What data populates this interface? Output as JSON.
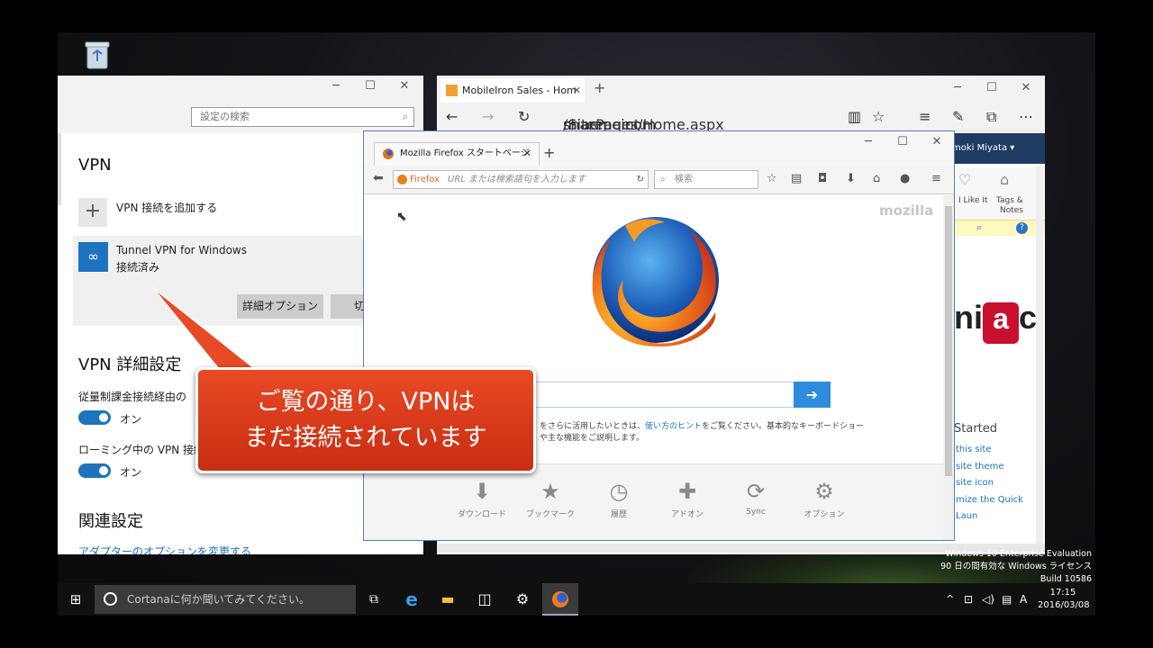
{
  "settings": {
    "search_placeholder": "設定の検索",
    "vpn_heading": "VPN",
    "add_vpn_label": "VPN 接続を追加する",
    "vpn_connection": {
      "name": "Tunnel VPN for Windows",
      "status": "接続済み"
    },
    "advanced_options_button": "詳細オプション",
    "disconnect_button_partial": "切",
    "advanced_heading": "VPN 詳細設定",
    "metered_label": "従量制課金接続経由の",
    "metered_toggle": "オン",
    "roaming_label": "ローミング中の VPN 接続",
    "roaming_toggle": "オン",
    "related_heading": "関連設定",
    "adapter_link": "アダプターのオプションを変更する"
  },
  "edge": {
    "tab_title": "MobileIron Sales - Hom",
    "url_prefix": "sharepoint.",
    "url_domain": "miacme.com",
    "url_path": "/SitePages/Home.aspx",
    "user_name": "moki Miyata",
    "like_label": "I Like It",
    "tags_label": "Tags &",
    "notes_label": "Notes",
    "logo_text": "ni",
    "logo_end": "c",
    "get_started": "Started",
    "links": [
      "this site",
      "site theme",
      "site icon",
      "mize the Quick Laun"
    ]
  },
  "firefox": {
    "tab_title": "Mozilla Firefox スタートページ",
    "url_badge": "Firefox",
    "url_placeholder": "URL または検索語句を入力します",
    "search_placeholder": "検索",
    "mozilla_wordmark": "mozilla",
    "tip_text_1": "をさらに活用したいときは、",
    "tip_link": "使い方のヒント",
    "tip_text_2": "をご覧ください。基本的なキーボードショー",
    "tip_text_3": "や主な機能をご説明します。",
    "launcher": [
      {
        "icon": "download-icon",
        "label": "ダウンロード"
      },
      {
        "icon": "bookmark-icon",
        "label": "ブックマーク"
      },
      {
        "icon": "history-icon",
        "label": "履歴"
      },
      {
        "icon": "addons-icon",
        "label": "アドオン"
      },
      {
        "icon": "sync-icon",
        "label": "Sync"
      },
      {
        "icon": "options-icon",
        "label": "オプション"
      }
    ]
  },
  "callout": {
    "line1": "ご覧の通り、VPNは",
    "line2": "まだ接続されています"
  },
  "watermark": {
    "line1": "Windows 10 Enterprise Evaluation",
    "line2": "90 日の間有効な Windows ライセンス",
    "line3": "Build 10586"
  },
  "taskbar": {
    "cortana_placeholder": "Cortanaに何か聞いてみてください。",
    "ime_indicator": "A",
    "time": "17:15",
    "date": "2016/03/08"
  },
  "colors": {
    "accent_blue": "#1e73be",
    "callout_red": "#d8391a",
    "sharepoint_header": "#1f3a63"
  }
}
